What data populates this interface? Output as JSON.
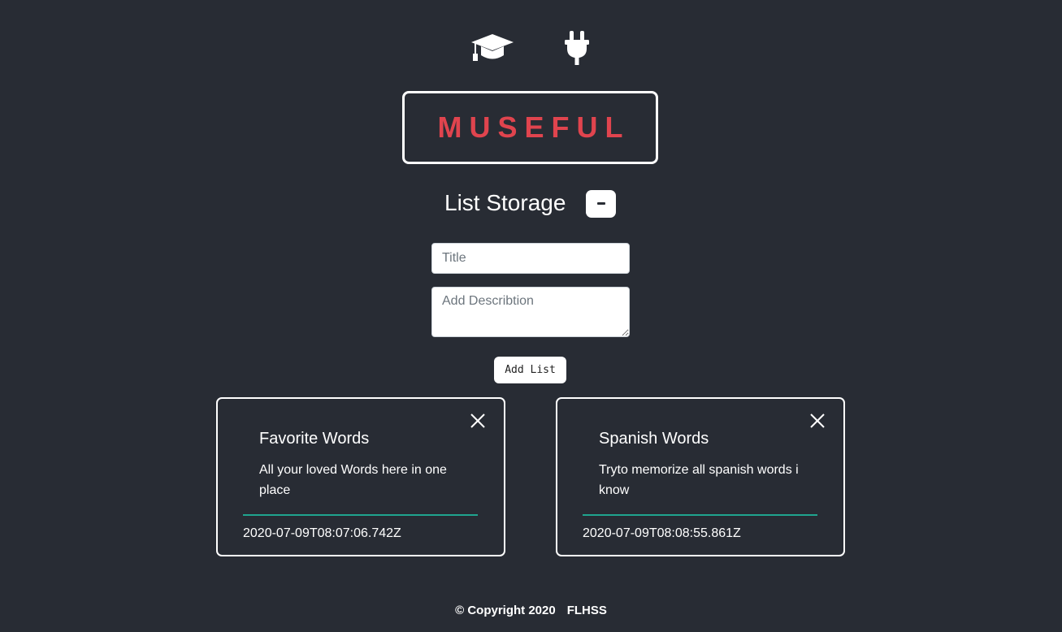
{
  "nav": {
    "icons": [
      {
        "name": "graduation-cap-icon"
      },
      {
        "name": "plug-icon"
      }
    ]
  },
  "logo": {
    "text": "MUSEFUL",
    "color": "#e0444e"
  },
  "section": {
    "heading": "List Storage",
    "collapse_label": "−"
  },
  "form": {
    "title_placeholder": "Title",
    "description_placeholder": "Add Describtion",
    "add_button_label": "Add List"
  },
  "lists": [
    {
      "title": "Favorite Words",
      "description": "All your loved Words here in one place",
      "date": "2020-07-09T08:07:06.742Z"
    },
    {
      "title": "Spanish Words",
      "description": "Tryto memorize all spanish words i know",
      "date": "2020-07-09T08:08:55.861Z"
    }
  ],
  "footer": {
    "copyright": "© Copyright 2020",
    "org": "FLHSS"
  },
  "colors": {
    "background": "#282c34",
    "accent": "#1fa58f",
    "brand": "#e0444e"
  }
}
